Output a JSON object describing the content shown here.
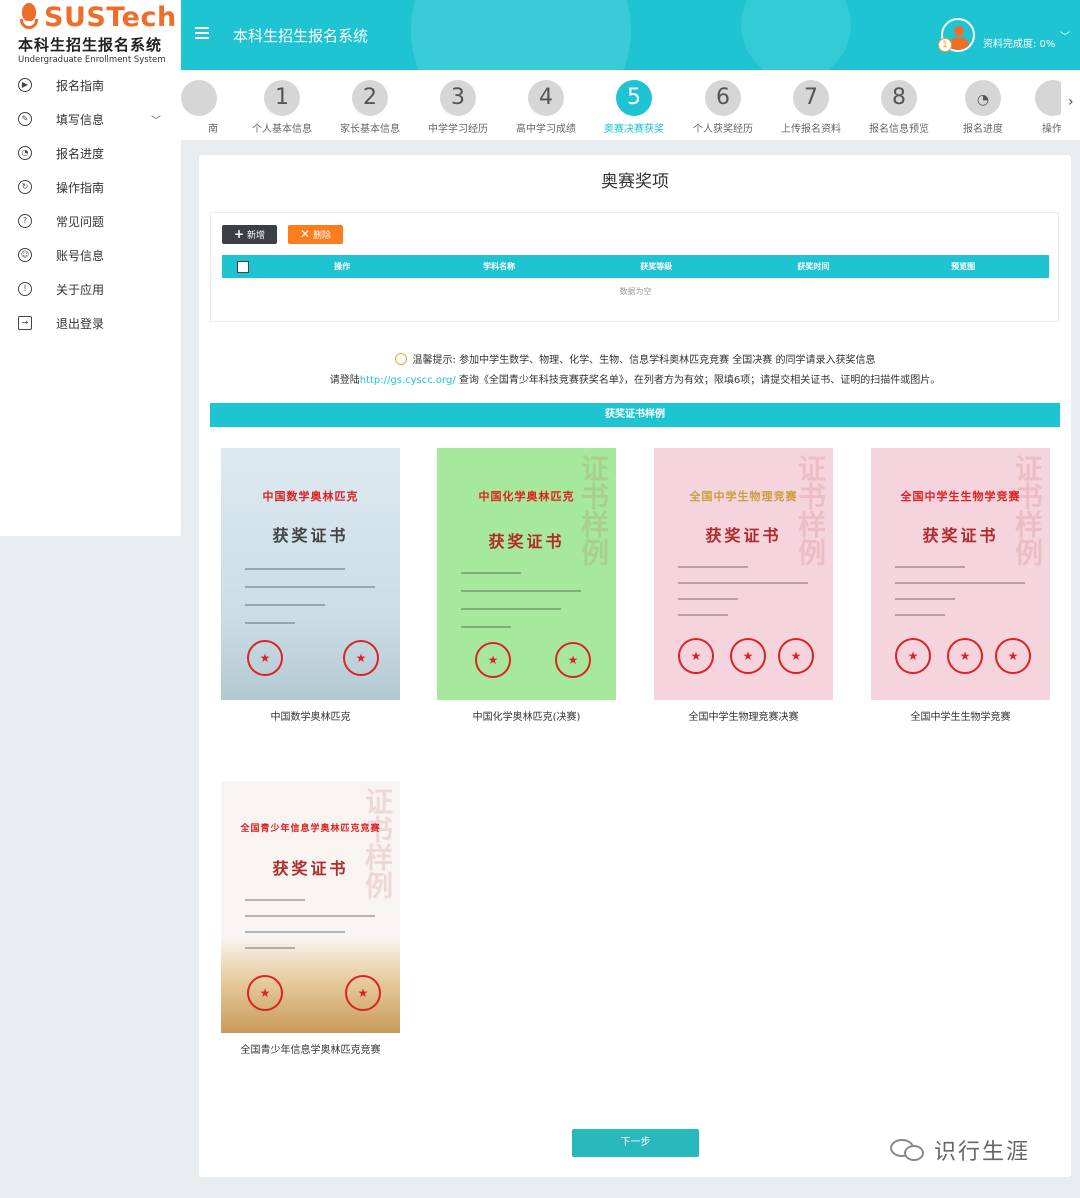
{
  "brand": {
    "logo_text": "SUSTech",
    "name_cn": "本科生招生报名系统",
    "name_en": "Undergraduate Enrollment System",
    "accent": "#1ec4d2",
    "logo_color": "#ed6d29"
  },
  "sidebar": {
    "items": [
      {
        "label": "报名指南",
        "icon": "play-circle-icon"
      },
      {
        "label": "填写信息",
        "icon": "edit-icon"
      },
      {
        "label": "报名进度",
        "icon": "gauge-icon"
      },
      {
        "label": "操作指南",
        "icon": "guide-icon"
      },
      {
        "label": "常见问题",
        "icon": "question-icon"
      },
      {
        "label": "账号信息",
        "icon": "user-circle-icon"
      },
      {
        "label": "关于应用",
        "icon": "info-icon"
      },
      {
        "label": "退出登录",
        "icon": "logout-icon"
      }
    ]
  },
  "header": {
    "title": "本科生招生报名系统",
    "badge": "1",
    "progress": "资料完成度: 0%"
  },
  "steps": [
    {
      "num": "",
      "label": "南"
    },
    {
      "num": "1",
      "label": "个人基本信息"
    },
    {
      "num": "2",
      "label": "家长基本信息"
    },
    {
      "num": "3",
      "label": "中学学习经历"
    },
    {
      "num": "4",
      "label": "高中学习成绩"
    },
    {
      "num": "5",
      "label": "奥赛决赛获奖",
      "active": true
    },
    {
      "num": "6",
      "label": "个人获奖经历"
    },
    {
      "num": "7",
      "label": "上传报名资料"
    },
    {
      "num": "8",
      "label": "报名信息预览"
    },
    {
      "num": "",
      "label": "报名进度"
    },
    {
      "num": "",
      "label": "操作"
    }
  ],
  "main": {
    "title": "奥赛奖项",
    "add_label": "新增",
    "delete_label": "删除",
    "columns": [
      "操作",
      "学科名称",
      "获奖等级",
      "获奖时间",
      "预览图"
    ],
    "empty_text": "数据为空",
    "tip_line1": "温馨提示: 参加中学生数学、物理、化学、生物、信息学科奥林匹克竞赛 全国决赛 的同学请录入获奖信息",
    "tip_line2_pre": "请登陆",
    "tip_link": "http://gs.cyscc.org/",
    "tip_line2_post": " 查询《全国青少年科技竞赛获奖名单》，在列者方为有效；限填6项；请提交相关证书、证明的扫描件或图片。",
    "sample_title": "获奖证书样例",
    "next_label": "下一步"
  },
  "certificates": [
    {
      "label": "中国数学奥林匹克",
      "header": "中国数学奥林匹克",
      "title": "获奖证书",
      "bg": "#dbe8ee"
    },
    {
      "label": "中国化学奥林匹克(决赛)",
      "header": "中国化学奥林匹克",
      "title": "获奖证书",
      "bg": "#a8e8a0"
    },
    {
      "label": "全国中学生物理竞赛决赛",
      "header": "全国中学生物理竞赛",
      "title": "获奖证书",
      "bg": "#f5d3dc"
    },
    {
      "label": "全国中学生生物学竞赛",
      "header": "全国中学生生物学竞赛",
      "title": "获奖证书",
      "bg": "#f5d3dc"
    },
    {
      "label": "全国青少年信息学奥林匹克竞赛",
      "header": "全国青少年信息学奥林匹克竞赛",
      "title": "获奖证书",
      "bg": "#f7f1ee"
    }
  ],
  "watermark": {
    "text": "识行生涯"
  }
}
